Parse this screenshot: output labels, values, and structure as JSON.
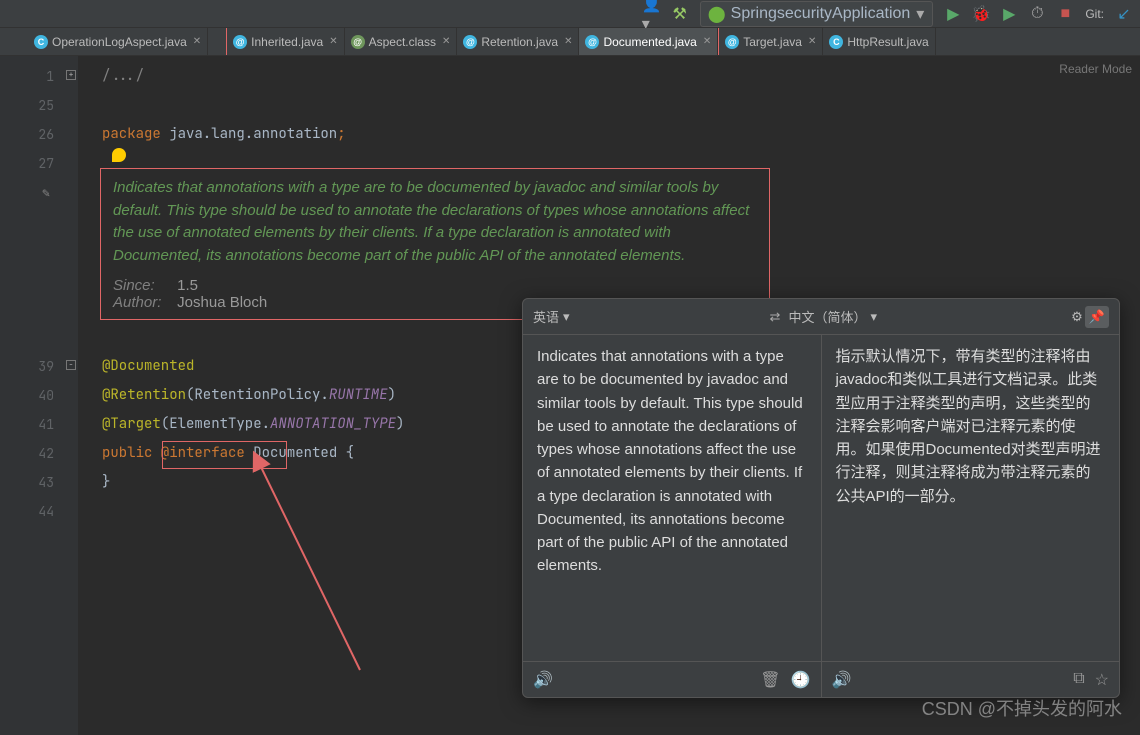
{
  "toolbar": {
    "run_config": "SpringsecurityApplication",
    "git_label": "Git:"
  },
  "tabs": [
    {
      "icon": "java",
      "label": "OperationLogAspect.java"
    },
    {
      "icon": "java",
      "label": "Inherited.java"
    },
    {
      "icon": "cls",
      "label": "Aspect.class"
    },
    {
      "icon": "java",
      "label": "Retention.java"
    },
    {
      "icon": "java",
      "label": "Documented.java",
      "active": true
    },
    {
      "icon": "java",
      "label": "Target.java"
    },
    {
      "icon": "java",
      "label": "HttpResult.java"
    }
  ],
  "reader_mode": "Reader Mode",
  "gutter": [
    "1",
    "25",
    "26",
    "27",
    "",
    "",
    "",
    "",
    "",
    "",
    "39",
    "40",
    "41",
    "42",
    "43",
    "44"
  ],
  "code": {
    "l1_fold": "/.../",
    "l26_pkg_kw": "package",
    "l26_pkg": " java.lang.annotation",
    "l26_semi": ";",
    "doc_text": "Indicates that annotations with a type are to be documented by javadoc and similar tools by default. This type should be used to annotate the declarations of types whose annotations affect the use of annotated elements by their clients. If a type declaration is annotated with Documented, its annotations become part of the public API of the annotated elements.",
    "since_label": "Since:",
    "since_val": "1.5",
    "author_label": "Author:",
    "author_val": "Joshua Bloch",
    "l39": "@Documented",
    "l40_a": "@Retention",
    "l40_b": "(RetentionPolicy.",
    "l40_c": "RUNTIME",
    "l40_d": ")",
    "l41_a": "@Target",
    "l41_b": "(ElementType.",
    "l41_c": "ANNOTATION_TYPE",
    "l41_d": ")",
    "l42_a": "public",
    "l42_b": " @interface ",
    "l42_c": "Documented {",
    "l43": "}"
  },
  "translator": {
    "src_lang": "英语",
    "dst_lang": "中文（简体）",
    "src_text": "Indicates that annotations with a type are to be documented by javadoc and similar tools by default. This type should be used to annotate the declarations of types whose annotations affect the use of annotated elements by their clients. If a type declaration is annotated with Documented, its annotations become part of the public API of the annotated elements.",
    "dst_text": "指示默认情况下，带有类型的注释将由javadoc和类似工具进行文档记录。此类型应用于注释类型的声明，这些类型的注释会影响客户端对已注释元素的使用。如果使用Documented对类型声明进行注释，则其注释将成为带注释元素的公共API的一部分。"
  },
  "watermark": "CSDN @不掉头发的阿水"
}
